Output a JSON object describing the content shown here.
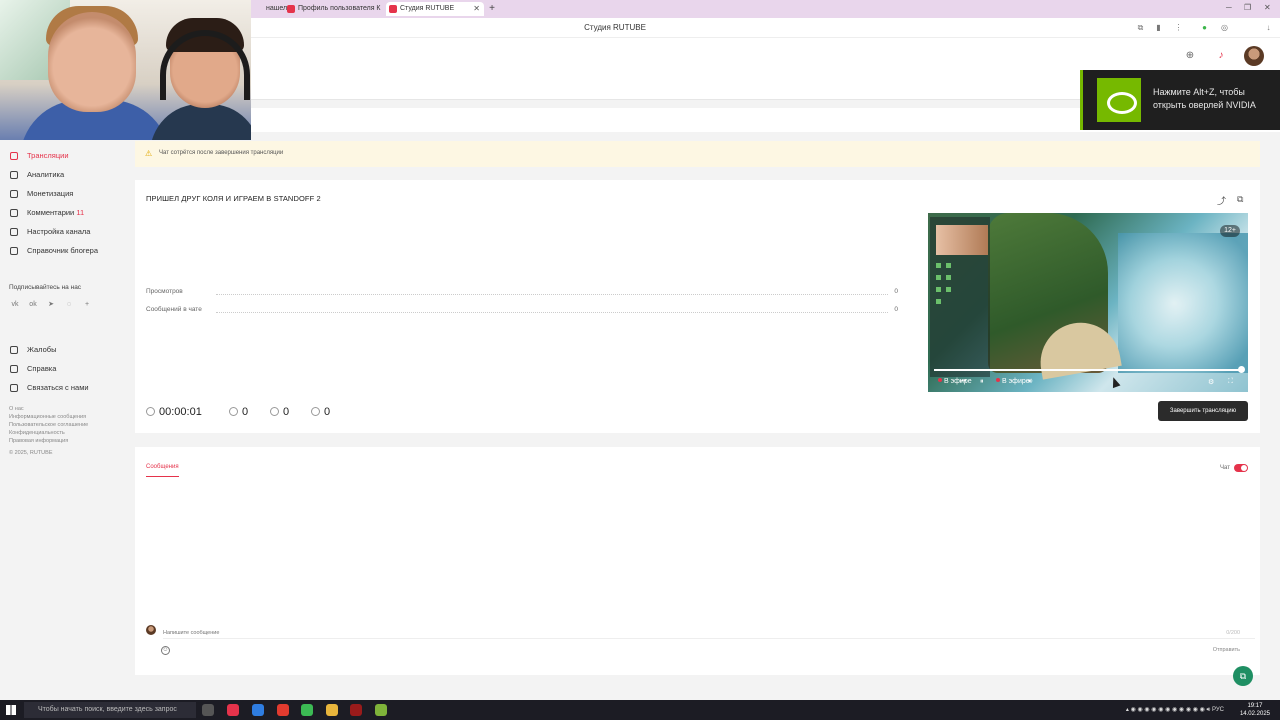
{
  "browser": {
    "tabs": [
      {
        "label": "нашел"
      },
      {
        "label": "Профиль пользователя К"
      },
      {
        "label": "Студия RUTUBE"
      }
    ],
    "title": "Студия RUTUBE"
  },
  "nvidia": {
    "text": "Нажмите Alt+Z, чтобы открыть оверлей NVIDIA"
  },
  "sidebar": {
    "items": [
      {
        "label": "Трансляции"
      },
      {
        "label": "Аналитика"
      },
      {
        "label": "Монетизация"
      },
      {
        "label": "Комментарии",
        "badge": "11"
      },
      {
        "label": "Настройка канала"
      },
      {
        "label": "Справочник блогера"
      }
    ],
    "subscribe_label": "Подписывайтесь на нас",
    "social_icons": [
      "vk-icon",
      "ok-icon",
      "telegram-icon",
      "viber-icon",
      "plus-icon"
    ],
    "support_items": [
      {
        "label": "Жалобы"
      },
      {
        "label": "Справка"
      },
      {
        "label": "Связаться с нами"
      }
    ],
    "footer_links": [
      "О нас",
      "Информационные сообщения",
      "Пользовательское соглашение",
      "Конфиденциальность",
      "Правовая информация",
      "© 2025, RUTUBE"
    ]
  },
  "warning": {
    "text": "Чат сотрётся после завершения трансляции"
  },
  "stream": {
    "title": "ПРИШЕЛ ДРУГ КОЛЯ И ИГРАЕМ В STANDOFF 2",
    "stats": [
      {
        "label": "Просмотров",
        "value": "0"
      },
      {
        "label": "Сообщений в чате",
        "value": "0"
      }
    ],
    "duration": "00:00:01",
    "viewers": "0",
    "likes": "0",
    "dislikes": "0",
    "end_button": "Завершить трансляцию"
  },
  "player": {
    "age": "12+",
    "live_label": "В эфире",
    "live_label_2": "В эфире",
    "progress": 1.0
  },
  "chat": {
    "tab": "Сообщения",
    "toggle_label": "Чат",
    "toggle_on": true,
    "input_placeholder": "Напишите сообщение",
    "counter": "0/200",
    "send": "Отправить"
  },
  "taskbar": {
    "search_placeholder": "Чтобы начать поиск, введите здесь запрос",
    "lang": "РУС",
    "time": "19:17",
    "date": "14.02.2025"
  },
  "colors": {
    "accent": "#e5334b",
    "nvidia": "#76b900"
  }
}
